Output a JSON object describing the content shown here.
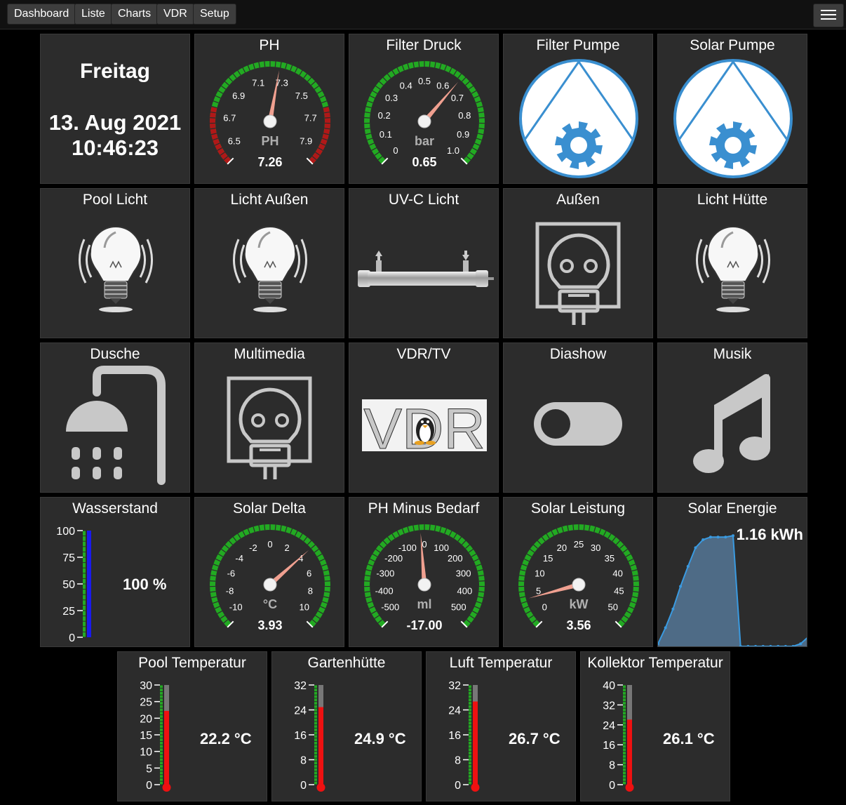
{
  "nav": {
    "items": [
      "Dashboard",
      "Liste",
      "Charts",
      "VDR",
      "Setup"
    ],
    "menu_icon": "hamburger-icon"
  },
  "colors": {
    "background": "#000000",
    "tile": "#2c2c2c",
    "gauge_green": "#22aa22",
    "gauge_red": "#b01818",
    "needle": "#f0a090",
    "icon_blue": "#3a8fd0",
    "icon_gray": "#c8c8c8",
    "level_blue": "#1a1aee",
    "thermo_red": "#ee1111"
  },
  "date": {
    "day": "Freitag",
    "date": "13. Aug 2021",
    "time": "10:46:23"
  },
  "gauges": [
    {
      "title": "PH",
      "unit": "PH",
      "value": "7.26",
      "value_num": 7.26,
      "min": 6.4,
      "max": 8.0,
      "ticks": [
        "6.5",
        "6.7",
        "6.9",
        "7.1",
        "7.3",
        "7.5",
        "7.7",
        "7.9"
      ],
      "tick_values": [
        6.5,
        6.7,
        6.9,
        7.1,
        7.3,
        7.5,
        7.7,
        7.9
      ],
      "red_zones": [
        [
          6.4,
          6.75
        ],
        [
          7.65,
          8.0
        ]
      ]
    },
    {
      "title": "Filter Druck",
      "unit": "bar",
      "value": "0.65",
      "value_num": 0.65,
      "min": 0,
      "max": 1.0,
      "ticks": [
        "0",
        "0.1",
        "0.2",
        "0.3",
        "0.4",
        "0.5",
        "0.6",
        "0.7",
        "0.8",
        "0.9",
        "1.0"
      ],
      "tick_values": [
        0,
        0.1,
        0.2,
        0.3,
        0.4,
        0.5,
        0.6,
        0.7,
        0.8,
        0.9,
        1.0
      ],
      "red_zones": []
    },
    {
      "title": "Solar Delta",
      "unit": "°C",
      "value": "3.93",
      "value_num": 3.93,
      "min": -11,
      "max": 11,
      "ticks": [
        "-10",
        "-8",
        "-6",
        "-4",
        "-2",
        "0",
        "2",
        "4",
        "6",
        "8",
        "10"
      ],
      "tick_values": [
        -10,
        -8,
        -6,
        -4,
        -2,
        0,
        2,
        4,
        6,
        8,
        10
      ],
      "red_zones": []
    },
    {
      "title": "PH Minus Bedarf",
      "unit": "ml",
      "value": "-17.00",
      "value_num": -17,
      "min": -550,
      "max": 550,
      "ticks": [
        "-500",
        "-400",
        "-300",
        "-200",
        "-100",
        "0",
        "100",
        "200",
        "300",
        "400",
        "500"
      ],
      "tick_values": [
        -500,
        -400,
        -300,
        -200,
        -100,
        0,
        100,
        200,
        300,
        400,
        500
      ],
      "red_zones": []
    },
    {
      "title": "Solar Leistung",
      "unit": "kW",
      "value": "3.56",
      "value_num": 3.56,
      "min": -2.5,
      "max": 52.5,
      "ticks": [
        "0",
        "5",
        "10",
        "15",
        "20",
        "25",
        "30",
        "35",
        "40",
        "45",
        "50"
      ],
      "tick_values": [
        0,
        5,
        10,
        15,
        20,
        25,
        30,
        35,
        40,
        45,
        50
      ],
      "red_zones": []
    }
  ],
  "pumps": [
    {
      "title": "Filter Pumpe",
      "icon": "pump-gear-icon"
    },
    {
      "title": "Solar Pumpe",
      "icon": "pump-gear-icon"
    }
  ],
  "switches": [
    {
      "title": "Pool Licht",
      "icon": "light-bulb-icon"
    },
    {
      "title": "Licht Außen",
      "icon": "light-bulb-icon"
    },
    {
      "title": "UV-C Licht",
      "icon": "uv-lamp-icon"
    },
    {
      "title": "Außen",
      "icon": "socket-plug-icon"
    },
    {
      "title": "Licht Hütte",
      "icon": "light-bulb-icon"
    },
    {
      "title": "Dusche",
      "icon": "shower-icon"
    },
    {
      "title": "Multimedia",
      "icon": "socket-plug-icon"
    },
    {
      "title": "VDR/TV",
      "icon": "vdr-logo-icon",
      "logo_text": "VDR"
    },
    {
      "title": "Diashow",
      "icon": "toggle-icon"
    },
    {
      "title": "Musik",
      "icon": "music-note-icon"
    }
  ],
  "level": {
    "title": "Wasserstand",
    "value": "100 %",
    "value_num": 100,
    "ticks": [
      "100",
      "75",
      "50",
      "25",
      "0"
    ],
    "tick_values": [
      100,
      75,
      50,
      25,
      0
    ],
    "min": 0,
    "max": 100
  },
  "energy": {
    "title": "Solar Energie",
    "value": "1.16 kWh",
    "series": [
      0.02,
      0.14,
      0.28,
      0.45,
      0.6,
      0.74,
      0.8,
      0.82,
      0.82,
      0.82,
      0.83,
      0.0,
      0.0,
      0.0,
      0.0,
      0.0,
      0.0,
      0.0,
      0.0,
      0.02,
      0.07
    ]
  },
  "thermos": [
    {
      "title": "Pool Temperatur",
      "value": "22.2 °C",
      "value_num": 22.2,
      "min": 0,
      "max": 30,
      "ticks": [
        "30",
        "25",
        "20",
        "15",
        "10",
        "5",
        "0"
      ],
      "tick_values": [
        30,
        25,
        20,
        15,
        10,
        5,
        0
      ]
    },
    {
      "title": "Gartenhütte",
      "value": "24.9 °C",
      "value_num": 24.9,
      "min": 0,
      "max": 32,
      "ticks": [
        "32",
        "24",
        "16",
        "8",
        "0"
      ],
      "tick_values": [
        32,
        24,
        16,
        8,
        0
      ]
    },
    {
      "title": "Luft Temperatur",
      "value": "26.7 °C",
      "value_num": 26.7,
      "min": 0,
      "max": 32,
      "ticks": [
        "32",
        "24",
        "16",
        "8",
        "0"
      ],
      "tick_values": [
        32,
        24,
        16,
        8,
        0
      ]
    },
    {
      "title": "Kollektor Temperatur",
      "value": "26.1 °C",
      "value_num": 26.1,
      "min": 0,
      "max": 40,
      "ticks": [
        "40",
        "32",
        "24",
        "16",
        "8",
        "0"
      ],
      "tick_values": [
        40,
        32,
        24,
        16,
        8,
        0
      ]
    }
  ]
}
